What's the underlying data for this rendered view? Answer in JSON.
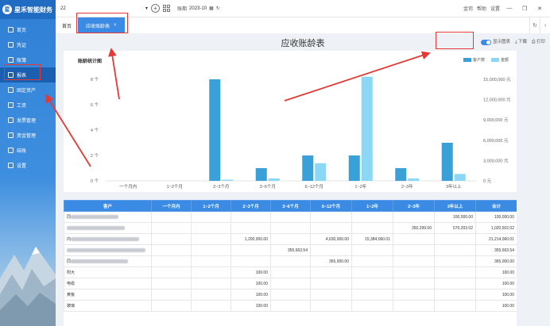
{
  "sidebar": {
    "brand": "星禾智能财务",
    "items": [
      {
        "label": "首页",
        "icon": "home-icon"
      },
      {
        "label": "凭证",
        "icon": "voucher-icon"
      },
      {
        "label": "账簿",
        "icon": "ledger-icon"
      },
      {
        "label": "报表",
        "icon": "report-icon"
      },
      {
        "label": "固定资产",
        "icon": "asset-icon"
      },
      {
        "label": "工资",
        "icon": "salary-icon"
      },
      {
        "label": "发票管理",
        "icon": "invoice-icon"
      },
      {
        "label": "资金管理",
        "icon": "fund-icon"
      },
      {
        "label": "结账",
        "icon": "close-account-icon"
      },
      {
        "label": "设置",
        "icon": "settings-icon"
      }
    ]
  },
  "topbar": {
    "org": "22",
    "period_label": "账期",
    "period_value": "2023-10",
    "links": [
      "金司",
      "帮助",
      "设置"
    ]
  },
  "tabs": {
    "home": "首页",
    "active": "应收账龄表",
    "close": "×"
  },
  "report": {
    "title": "应收账龄表",
    "toggle_label": "显示图表",
    "download": "下载",
    "print": "打印"
  },
  "chart_data": {
    "type": "bar",
    "title": "账龄统计图",
    "categories": [
      "一个月内",
      "1~2个月",
      "2~3个月",
      "3~6个月",
      "6~12个月",
      "1~2年",
      "2~3年",
      "3年以上"
    ],
    "series": [
      {
        "name": "客户数",
        "axis": "left",
        "color": "#3aa0d8",
        "values": [
          0,
          0,
          8,
          1,
          2,
          2,
          1,
          3
        ]
      },
      {
        "name": "金额",
        "axis": "right",
        "color": "#8ad8f5",
        "values": [
          0,
          0,
          600,
          355663.54,
          2600000,
          15384060.01,
          350299,
          1020000
        ]
      }
    ],
    "y_left": {
      "ticks": [
        "0 个",
        "2 个",
        "4 个",
        "6 个",
        "8 个"
      ],
      "max": 8
    },
    "y_right": {
      "ticks": [
        "0 元",
        "3,000,000 元",
        "6,000,000 元",
        "9,000,000 元",
        "12,000,000 元",
        "15,000,000 元"
      ],
      "max": 15000000
    },
    "legend_position": "top-right",
    "grid": false
  },
  "table": {
    "headers": [
      "客户",
      "一个月内",
      "1~2个月",
      "2~3个月",
      "3~6个月",
      "6~12个月",
      "1~2年",
      "2~3年",
      "3年以上",
      "合计"
    ],
    "rows": [
      [
        "同",
        "",
        "",
        "",
        "",
        "",
        "",
        "",
        "100,000.00",
        "100,000.00"
      ],
      [
        "",
        "",
        "",
        "",
        "",
        "",
        "",
        "350,299.00",
        "670,203.02",
        "1,020,502.02"
      ],
      [
        "内",
        "",
        "",
        "1,200,000.00",
        "",
        "4,630,000.00",
        "15,384,060.01",
        "",
        "",
        "21,214,060.01"
      ],
      [
        "",
        "",
        "",
        "",
        "355,663.54",
        "",
        "",
        "",
        "",
        "355,663.54"
      ],
      [
        "同",
        "",
        "",
        "",
        "",
        "365,000.00",
        "",
        "",
        "",
        "365,000.00"
      ],
      [
        "附大",
        "",
        "",
        "100.00",
        "",
        "",
        "",
        "",
        "",
        "100.00"
      ],
      [
        "电缆",
        "",
        "",
        "100.00",
        "",
        "",
        "",
        "",
        "",
        "100.00"
      ],
      [
        "黄板",
        "",
        "",
        "100.00",
        "",
        "",
        "",
        "",
        "",
        "100.00"
      ],
      [
        "玻璃",
        "",
        "",
        "100.00",
        "",
        "",
        "",
        "",
        "",
        "100.00"
      ]
    ]
  }
}
